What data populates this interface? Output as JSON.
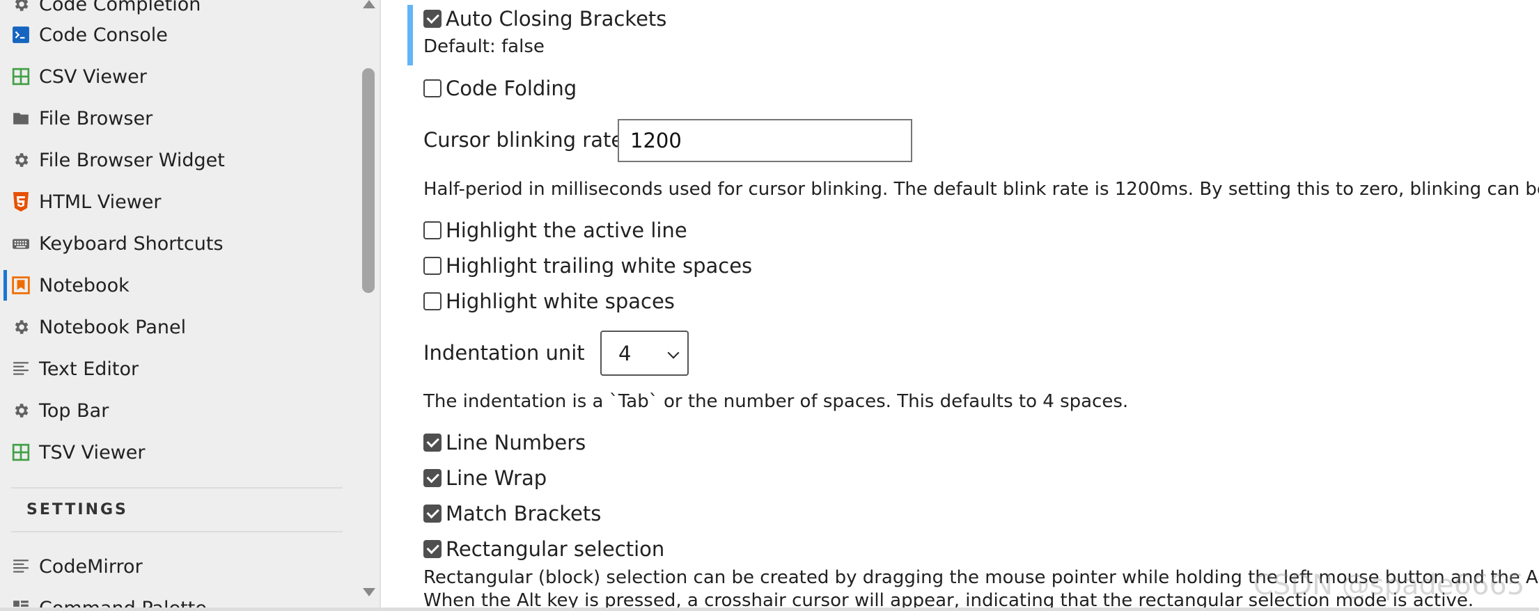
{
  "sidebar": {
    "items": [
      {
        "label": "Code Completion",
        "icon": "gear-icon"
      },
      {
        "label": "Code Console",
        "icon": "console-icon"
      },
      {
        "label": "CSV Viewer",
        "icon": "spreadsheet-icon"
      },
      {
        "label": "File Browser",
        "icon": "folder-icon"
      },
      {
        "label": "File Browser Widget",
        "icon": "gear-icon"
      },
      {
        "label": "HTML Viewer",
        "icon": "html5-icon"
      },
      {
        "label": "Keyboard Shortcuts",
        "icon": "keyboard-icon"
      },
      {
        "label": "Notebook",
        "icon": "notebook-icon",
        "active": true
      },
      {
        "label": "Notebook Panel",
        "icon": "gear-icon"
      },
      {
        "label": "Text Editor",
        "icon": "text-lines-icon"
      },
      {
        "label": "Top Bar",
        "icon": "gear-icon"
      },
      {
        "label": "TSV Viewer",
        "icon": "spreadsheet-icon"
      }
    ],
    "settings_heading": "SETTINGS",
    "settings_items": [
      {
        "label": "CodeMirror",
        "icon": "text-lines-icon"
      },
      {
        "label": "Command Palette",
        "icon": "palette-icon"
      }
    ]
  },
  "settings": {
    "auto_closing_brackets": {
      "label": "Auto Closing Brackets",
      "checked": true,
      "default_text": "Default: false"
    },
    "code_folding": {
      "label": "Code Folding",
      "checked": false
    },
    "cursor_blink_rate": {
      "label": "Cursor blinking rate",
      "value": "1200",
      "description": "Half-period in milliseconds used for cursor blinking. The default blink rate is 1200ms. By setting this to zero, blinking can be disab"
    },
    "highlight_active_line": {
      "label": "Highlight the active line",
      "checked": false
    },
    "highlight_trailing_white_spaces": {
      "label": "Highlight trailing white spaces",
      "checked": false
    },
    "highlight_white_spaces": {
      "label": "Highlight white spaces",
      "checked": false
    },
    "indentation_unit": {
      "label": "Indentation unit",
      "value": "4",
      "description": "The indentation is a `Tab` or the number of spaces. This defaults to 4 spaces."
    },
    "line_numbers": {
      "label": "Line Numbers",
      "checked": true
    },
    "line_wrap": {
      "label": "Line Wrap",
      "checked": true
    },
    "match_brackets": {
      "label": "Match Brackets",
      "checked": true
    },
    "rectangular_selection": {
      "label": "Rectangular selection",
      "checked": true,
      "description_1": "Rectangular (block) selection can be created by dragging the mouse pointer while holding the left mouse button and the Alt key.",
      "description_2": "When the Alt key is pressed, a crosshair cursor will appear, indicating that the rectangular selection mode is active."
    }
  },
  "watermark": "CSDN @spade6665",
  "colors": {
    "active_indicator": "#1976d2",
    "modified_indicator": "#64b5f6",
    "spreadsheet_icon": "#43a047",
    "html5_icon": "#e65100",
    "notebook_icon": "#ef6c00",
    "console_icon": "#1565c0"
  }
}
